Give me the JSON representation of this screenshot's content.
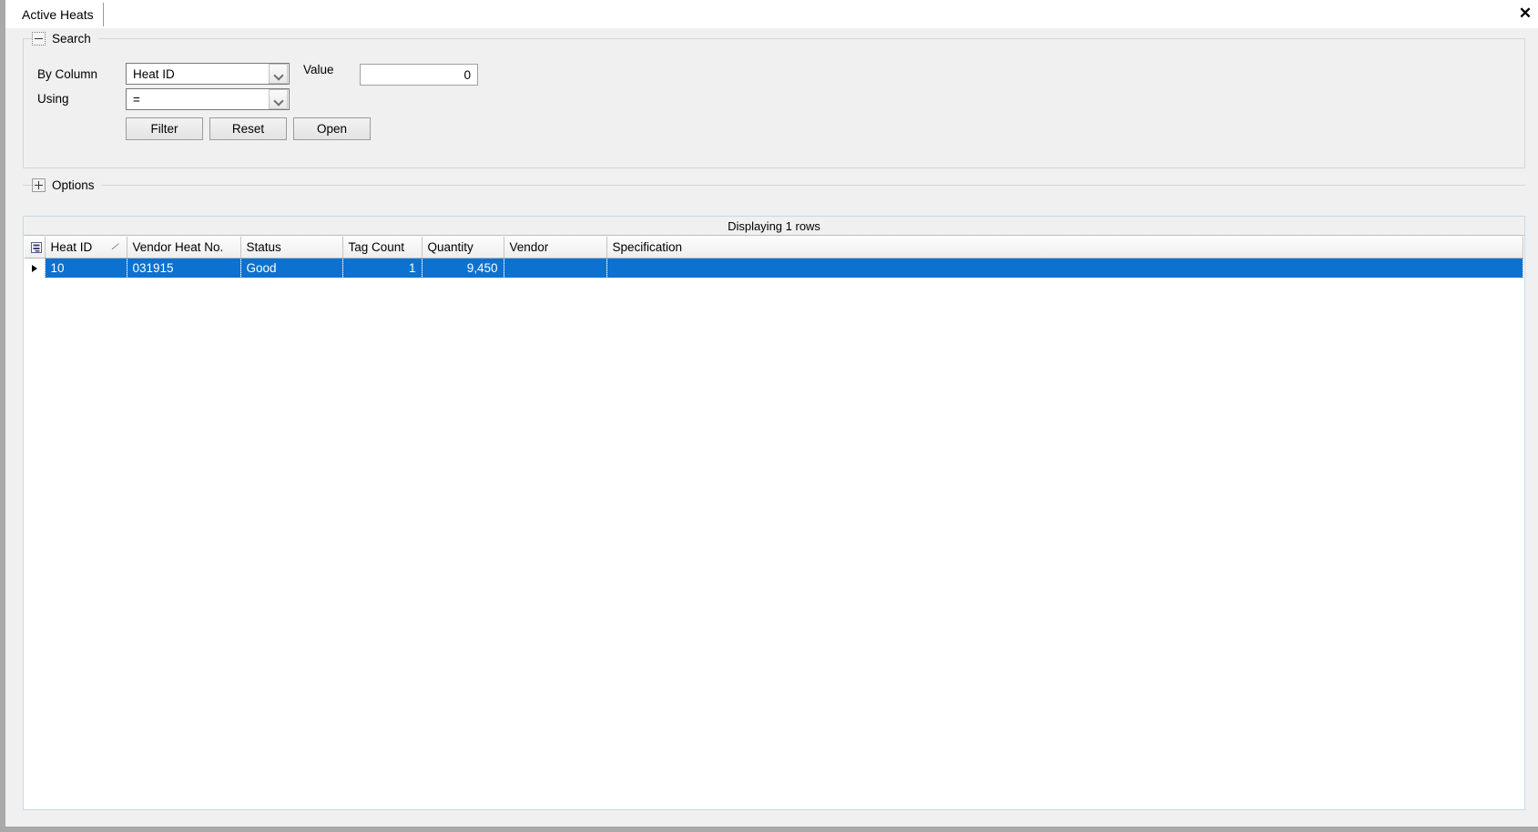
{
  "window": {
    "close_label": "✕"
  },
  "tabs": [
    {
      "label": "Active Heats"
    }
  ],
  "search": {
    "title": "Search",
    "expander_icon": "minus-box-icon",
    "by_column_label": "By Column",
    "by_column_value": "Heat ID",
    "using_label": "Using",
    "using_value": "=",
    "value_label": "Value",
    "value_field": "0",
    "buttons": {
      "filter": "Filter",
      "reset": "Reset",
      "open": "Open"
    }
  },
  "options": {
    "title": "Options",
    "expander_icon": "plus-box-icon"
  },
  "grid": {
    "caption": "Displaying 1 rows",
    "sort_indicator": "⁄",
    "columns": [
      {
        "key": "heat_id",
        "label": "Heat ID",
        "sorted": true
      },
      {
        "key": "vendor_heat_no",
        "label": "Vendor Heat No."
      },
      {
        "key": "status",
        "label": "Status"
      },
      {
        "key": "tag_count",
        "label": "Tag Count"
      },
      {
        "key": "quantity",
        "label": "Quantity"
      },
      {
        "key": "vendor",
        "label": "Vendor"
      },
      {
        "key": "specification",
        "label": "Specification"
      }
    ],
    "rows": [
      {
        "selected": true,
        "heat_id": "10",
        "vendor_heat_no": "031915",
        "status": "Good",
        "tag_count": "1",
        "quantity": "9,450",
        "vendor": "",
        "specification": ""
      }
    ]
  },
  "colors": {
    "selection": "#0d71cf",
    "panel": "#f0f0f0",
    "grid_border": "#c6d9ea"
  }
}
